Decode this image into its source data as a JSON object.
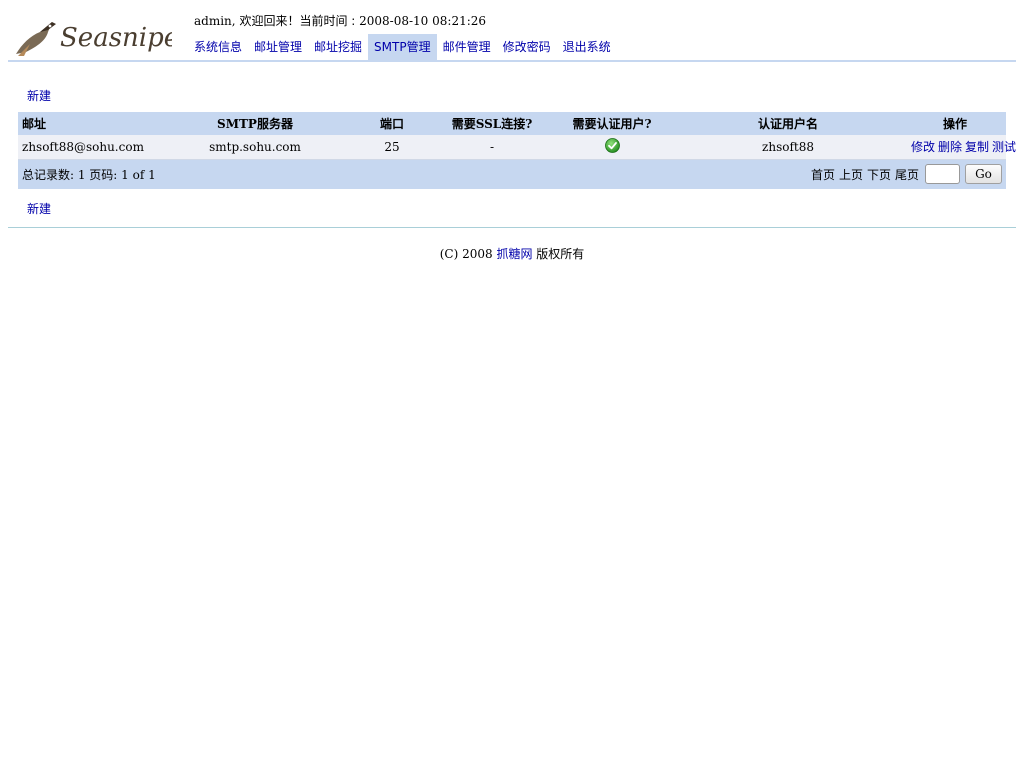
{
  "header": {
    "logo_text": "Seasnipe",
    "welcome_user": "admin,",
    "welcome_text": "欢迎回来！当前时间 : ",
    "current_time": "2008-08-10 08:21:26"
  },
  "nav": [
    {
      "label": "系统信息",
      "active": false
    },
    {
      "label": "邮址管理",
      "active": false
    },
    {
      "label": "邮址挖掘",
      "active": false
    },
    {
      "label": "SMTP管理",
      "active": true
    },
    {
      "label": "邮件管理",
      "active": false
    },
    {
      "label": "修改密码",
      "active": false
    },
    {
      "label": "退出系统",
      "active": false
    }
  ],
  "actions": {
    "new_label": "新建"
  },
  "table": {
    "columns": [
      "邮址",
      "SMTP服务器",
      "端口",
      "需要SSL连接?",
      "需要认证用户?",
      "认证用户名",
      "操作"
    ],
    "rows": [
      {
        "email": "zhsoft88@sohu.com",
        "server": "smtp.sohu.com",
        "port": "25",
        "ssl": "-",
        "auth_icon": "check-circle-icon",
        "auth_user": "zhsoft88",
        "ops": [
          "修改",
          "删除",
          "复制",
          "测试"
        ]
      }
    ]
  },
  "pager": {
    "summary": "总记录数: 1 页码: 1 of 1",
    "first": "首页",
    "prev": "上页",
    "next": "下页",
    "last": "尾页",
    "page_input_value": "",
    "go_label": "Go"
  },
  "footer": {
    "prefix": "(C) 2008 ",
    "link": "抓糖网",
    "suffix": " 版权所有"
  },
  "colors": {
    "accent": "#c6d7f0",
    "row_bg": "#eef0f6",
    "link": "#0000aa"
  }
}
